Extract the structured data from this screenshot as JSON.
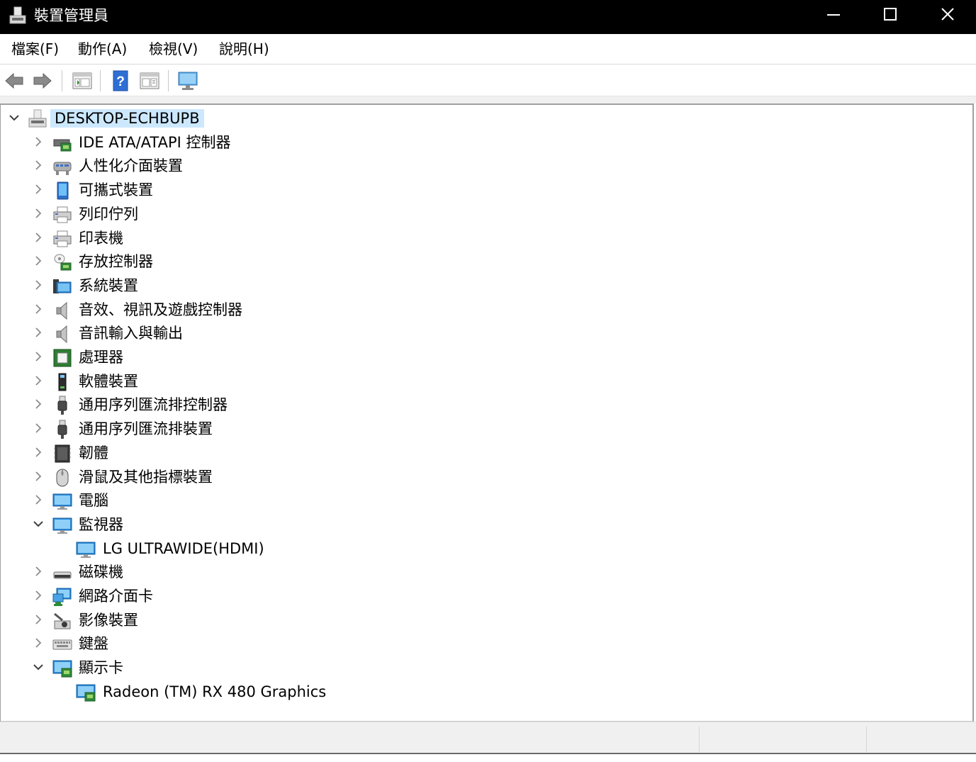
{
  "window": {
    "title": "裝置管理員",
    "controls": {
      "minimize": "minimize-icon",
      "maximize": "maximize-icon",
      "close": "close-icon"
    }
  },
  "menu": [
    "檔案(F)",
    "動作(A)",
    "檢視(V)",
    "說明(H)"
  ],
  "toolbar": [
    "back-arrow-icon",
    "forward-arrow-icon",
    "properties-icon",
    "help-icon",
    "view-icon",
    "monitor-scan-icon"
  ],
  "tree": {
    "root": {
      "label": "DESKTOP-ECHBUPB",
      "icon": "computer-icon",
      "expanded": true
    },
    "categories": [
      {
        "label": "IDE ATA/ATAPI 控制器",
        "icon": "ide-controller-icon",
        "expanded": false,
        "children": []
      },
      {
        "label": "人性化介面裝置",
        "icon": "hid-icon",
        "expanded": false,
        "children": []
      },
      {
        "label": "可攜式裝置",
        "icon": "portable-device-icon",
        "expanded": false,
        "children": []
      },
      {
        "label": "列印佇列",
        "icon": "print-queue-icon",
        "expanded": false,
        "children": []
      },
      {
        "label": "印表機",
        "icon": "printer-icon",
        "expanded": false,
        "children": []
      },
      {
        "label": "存放控制器",
        "icon": "storage-controller-icon",
        "expanded": false,
        "children": []
      },
      {
        "label": "系統裝置",
        "icon": "system-device-icon",
        "expanded": false,
        "children": []
      },
      {
        "label": "音效、視訊及遊戲控制器",
        "icon": "speaker-icon",
        "expanded": false,
        "children": []
      },
      {
        "label": "音訊輸入與輸出",
        "icon": "speaker-icon",
        "expanded": false,
        "children": []
      },
      {
        "label": "處理器",
        "icon": "processor-icon",
        "expanded": false,
        "children": []
      },
      {
        "label": "軟體裝置",
        "icon": "software-device-icon",
        "expanded": false,
        "children": []
      },
      {
        "label": "通用序列匯流排控制器",
        "icon": "usb-icon",
        "expanded": false,
        "children": []
      },
      {
        "label": "通用序列匯流排裝置",
        "icon": "usb-icon",
        "expanded": false,
        "children": []
      },
      {
        "label": "韌體",
        "icon": "firmware-icon",
        "expanded": false,
        "children": []
      },
      {
        "label": "滑鼠及其他指標裝置",
        "icon": "mouse-icon",
        "expanded": false,
        "children": []
      },
      {
        "label": "電腦",
        "icon": "computer-monitor-icon",
        "expanded": false,
        "children": []
      },
      {
        "label": "監視器",
        "icon": "monitor-icon",
        "expanded": true,
        "children": [
          {
            "label": "LG ULTRAWIDE(HDMI)",
            "icon": "monitor-icon"
          }
        ]
      },
      {
        "label": "磁碟機",
        "icon": "disk-drive-icon",
        "expanded": false,
        "children": []
      },
      {
        "label": "網路介面卡",
        "icon": "network-adapter-icon",
        "expanded": false,
        "children": []
      },
      {
        "label": "影像裝置",
        "icon": "imaging-device-icon",
        "expanded": false,
        "children": []
      },
      {
        "label": "鍵盤",
        "icon": "keyboard-icon",
        "expanded": false,
        "children": []
      },
      {
        "label": "顯示卡",
        "icon": "display-adapter-icon",
        "expanded": true,
        "children": [
          {
            "label": "Radeon (TM) RX 480 Graphics",
            "icon": "display-adapter-icon"
          }
        ]
      }
    ]
  },
  "colors": {
    "titlebar": "#000000",
    "selection": "#cce8ff",
    "statusbar": "#f0f0f0"
  }
}
